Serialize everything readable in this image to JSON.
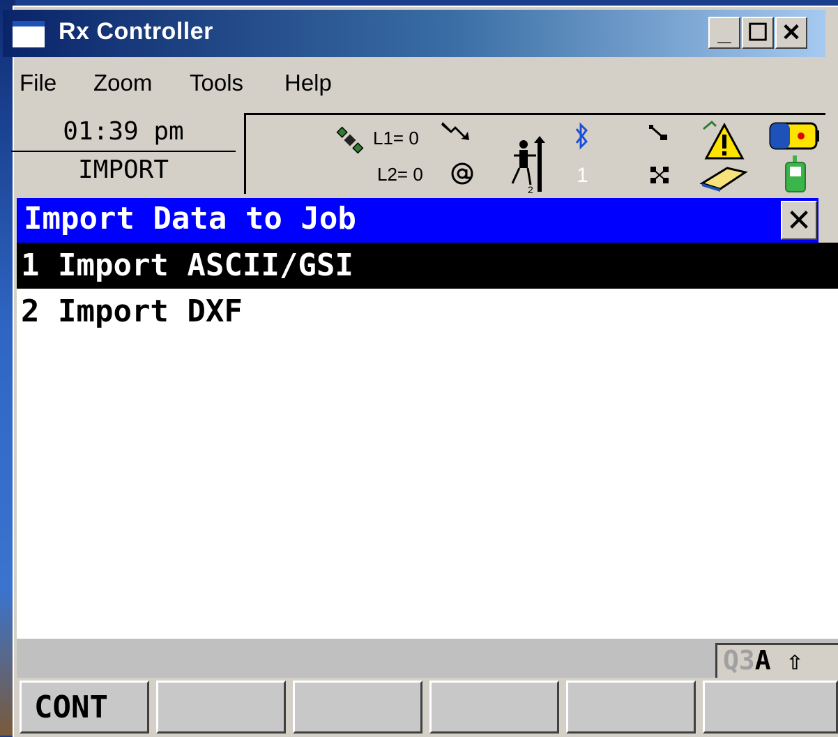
{
  "window": {
    "title": "Rx Controller",
    "buttons": {
      "minimize": "_",
      "maximize": "☐",
      "close": "✕"
    }
  },
  "menu": [
    {
      "label": "File"
    },
    {
      "label": "Zoom"
    },
    {
      "label": "Tools"
    },
    {
      "label": "Help"
    }
  ],
  "status": {
    "time": "01:39 pm",
    "mode": "IMPORT",
    "l1": "L1= 0",
    "l2": "L2= 0",
    "bt_count": "1",
    "icons": [
      "satellite-icon",
      "signal-arrow-icon",
      "at-sign-icon",
      "surveyor-icon",
      "bluetooth-icon",
      "network-icon",
      "warning-icon",
      "battery-icon",
      "controller-icon"
    ]
  },
  "dialog": {
    "title": "Import Data to Job",
    "close": "✕",
    "items": [
      {
        "label": "1 Import ASCII/GSI",
        "selected": true
      },
      {
        "label": "2 Import DXF",
        "selected": false
      }
    ]
  },
  "indicator": {
    "q": "Q3",
    "a": "A",
    "shift": "⇧"
  },
  "fkeys": [
    "CONT",
    "",
    "",
    "",
    "",
    ""
  ],
  "colors": {
    "dialog_title_bg": "#0000ff",
    "selected_row_bg": "#000000",
    "window_bg": "#d4d0c8"
  }
}
